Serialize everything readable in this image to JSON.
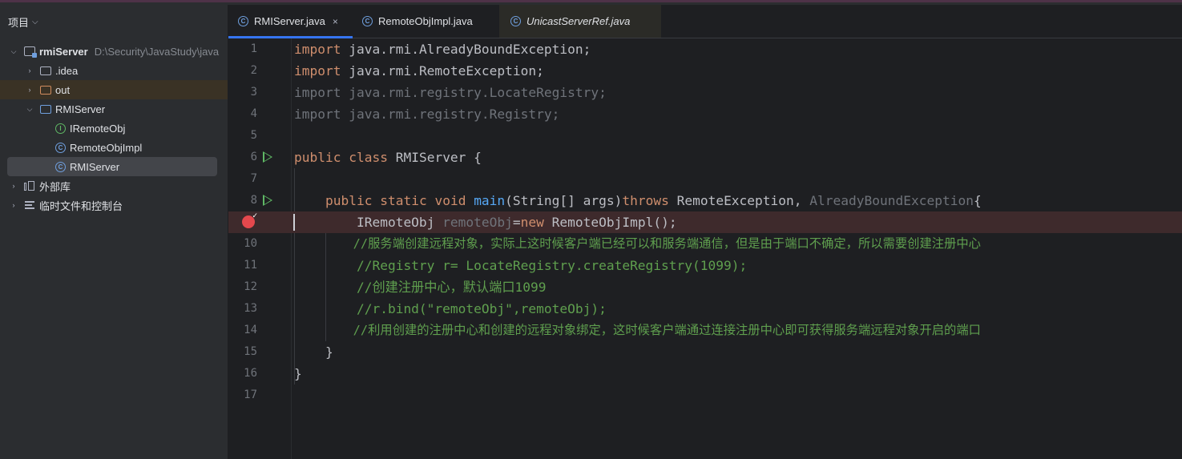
{
  "sidebar": {
    "title": "项目",
    "tree": [
      {
        "label": "rmiServer",
        "path": "D:\\Security\\JavaStudy\\java"
      },
      {
        "label": ".idea"
      },
      {
        "label": "out"
      },
      {
        "label": "RMIServer"
      },
      {
        "label": "IRemoteObj",
        "icon_letter": "I"
      },
      {
        "label": "RemoteObjImpl",
        "icon_letter": "C"
      },
      {
        "label": "RMIServer",
        "icon_letter": "C"
      },
      {
        "label": "外部库"
      },
      {
        "label": "临时文件和控制台"
      }
    ]
  },
  "tabs": [
    {
      "label": "RMIServer.java",
      "close": "×",
      "icon_letter": "C"
    },
    {
      "label": "RemoteObjImpl.java",
      "icon_letter": "C"
    },
    {
      "label": "UnicastServerRef.java",
      "icon_letter": "C"
    }
  ],
  "editor": {
    "line_numbers": [
      "1",
      "2",
      "3",
      "4",
      "5",
      "6",
      "7",
      "8",
      "",
      "10",
      "11",
      "12",
      "13",
      "14",
      "15",
      "16",
      "17"
    ],
    "code": {
      "l1": [
        "import",
        " java.rmi.AlreadyBoundException;"
      ],
      "l2": [
        "import",
        " java.rmi.RemoteException;"
      ],
      "l3": "import java.rmi.registry.LocateRegistry;",
      "l4": "import java.rmi.registry.Registry;",
      "l6": [
        "public",
        " ",
        "class",
        " RMIServer {"
      ],
      "l8": [
        "    ",
        "public",
        " ",
        "static",
        " ",
        "void",
        " ",
        "main",
        "(String[] args)",
        "throws",
        " RemoteException, ",
        "AlreadyBoundException",
        "{"
      ],
      "l9": [
        "        IRemoteObj ",
        "remoteObj",
        "=",
        "new",
        " RemoteObjImpl();"
      ],
      "l10": "        //服务端创建远程对象，实际上这时候客户端已经可以和服务端通信，但是由于端口不确定，所以需要创建注册中心",
      "l11": "        //Registry r= LocateRegistry.createRegistry(1099);",
      "l12": "        //创建注册中心，默认端口1099",
      "l13": "        //r.bind(\"remoteObj\",remoteObj);",
      "l14": "        //利用创建的注册中心和创建的远程对象绑定，这时候客户端通过连接注册中心即可获得服务端远程对象开启的端口",
      "l15": "    }",
      "l16": "}"
    }
  },
  "colors": {
    "keyword": "#cf8e6d",
    "function": "#56a8f5",
    "comment": "#5f9f4e",
    "breakpoint": "#e5484d",
    "run_gutter": "#5fb865",
    "tab_active_underline": "#3574f0"
  }
}
